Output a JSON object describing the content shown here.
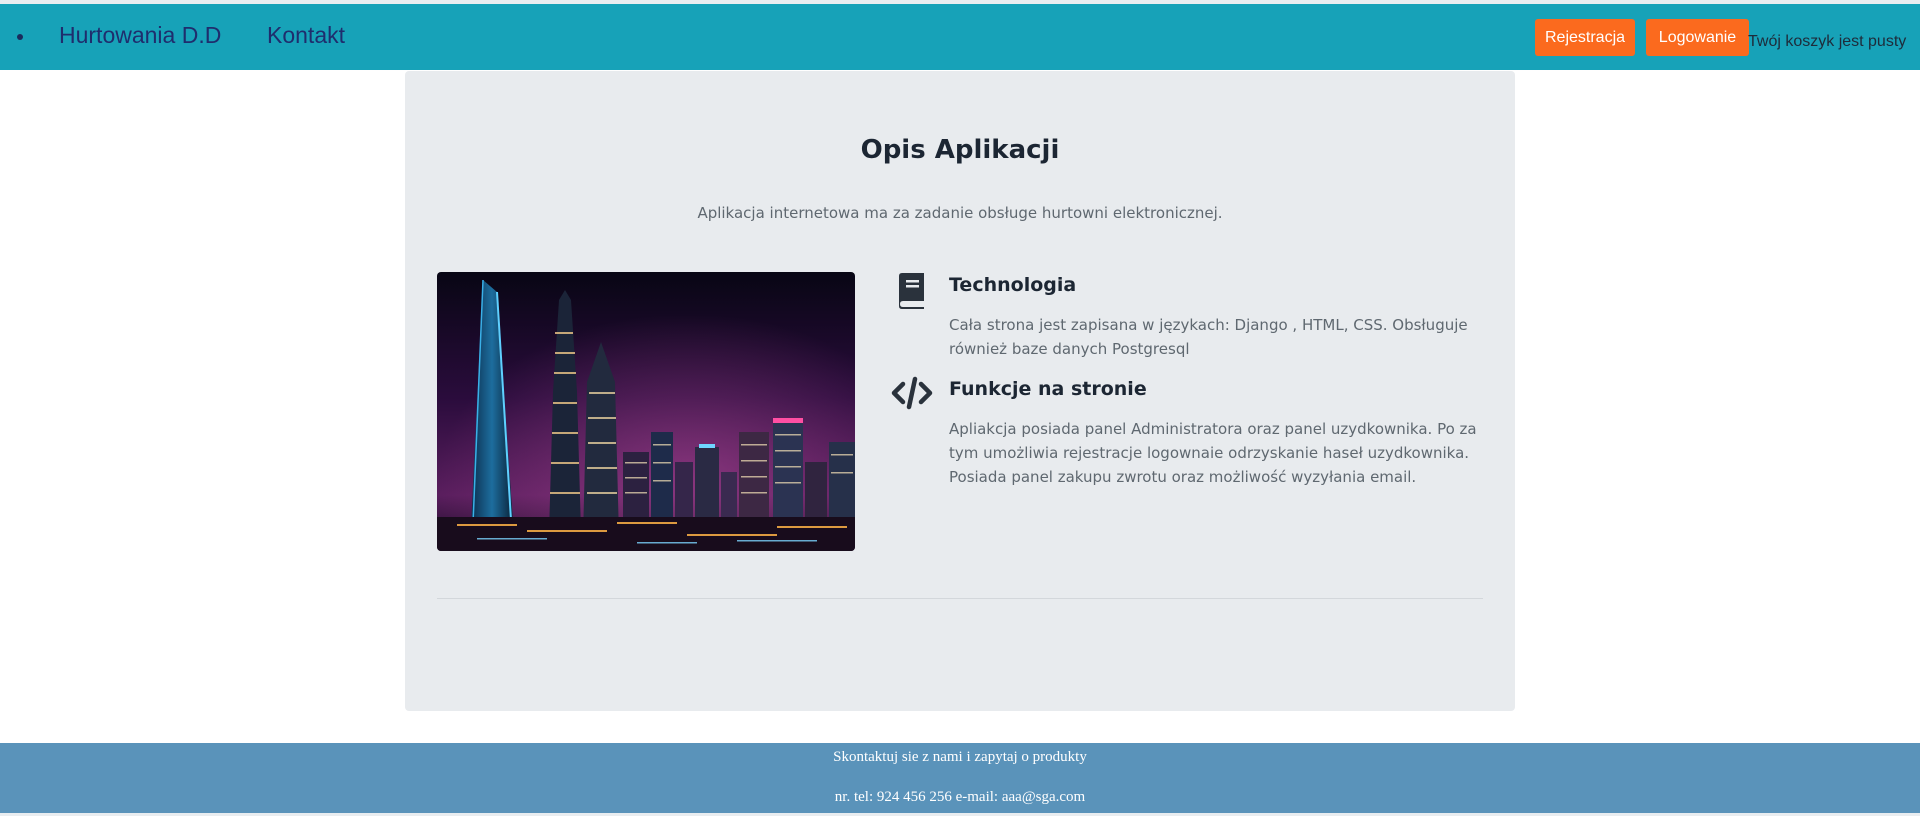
{
  "navbar": {
    "brand": "Hurtowania D.D",
    "contact": "Kontakt",
    "register_label": "Rejestracja",
    "login_label": "Logowanie",
    "cart_status": "Twój koszyk jest pusty",
    "background_color": "#17a2b8",
    "button_color": "#fb6a1e"
  },
  "main": {
    "title": "Opis Aplikacji",
    "subtitle": "Aplikacja internetowa ma za zadanie obsługe hurtowni elektronicznej.",
    "image": "city-skyline-night-photo",
    "features": [
      {
        "icon": "book-icon",
        "title": "Technologia",
        "description": "Cała strona jest zapisana w językach: Django , HTML, CSS. Obsługuje również baze danych Postgresql"
      },
      {
        "icon": "code-icon",
        "title": "Funkcje na stronie",
        "description": "Apliakcja posiada panel Administratora oraz panel uzydkownika. Po za tym umożliwia rejestracje logownaie odrzyskanie haseł uzydkownika. Posiada panel zakupu zwrotu oraz możliwość wyzyłania email."
      }
    ]
  },
  "footer": {
    "line1": "Skontaktuj sie z nami i zapytaj o produkty",
    "line2": "nr. tel: 924 456 256 e-mail: aaa@sga.com",
    "background_color": "#5a93ba"
  }
}
